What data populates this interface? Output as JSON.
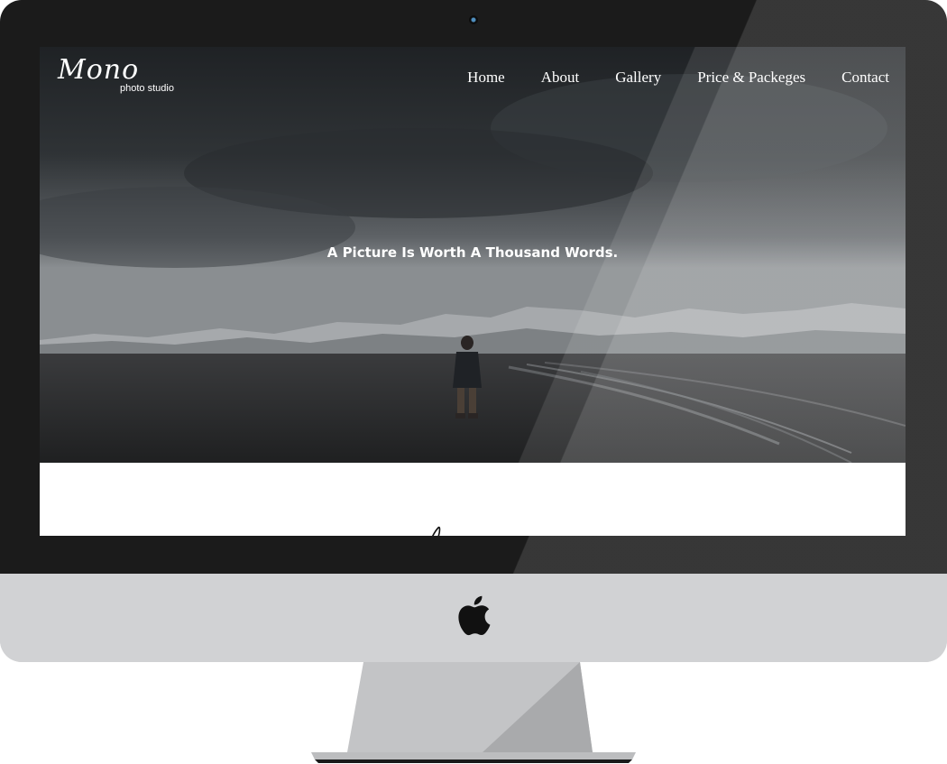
{
  "site": {
    "logo": {
      "script": "Mono",
      "subtitle": "photo studio"
    },
    "nav": [
      {
        "label": "Home"
      },
      {
        "label": "About"
      },
      {
        "label": "Gallery"
      },
      {
        "label": "Price & Packeges"
      },
      {
        "label": "Contact"
      }
    ],
    "hero": {
      "tagline": "A Picture Is Worth A Thousand Words."
    }
  },
  "icons": {
    "device_logo": "apple-logo",
    "camera": "webcam"
  },
  "colors": {
    "bezel": "#1b1b1b",
    "chin": "#d1d2d4",
    "stand": "#bdbdbf",
    "nav_text": "#ffffff",
    "content_bg": "#ffffff"
  }
}
